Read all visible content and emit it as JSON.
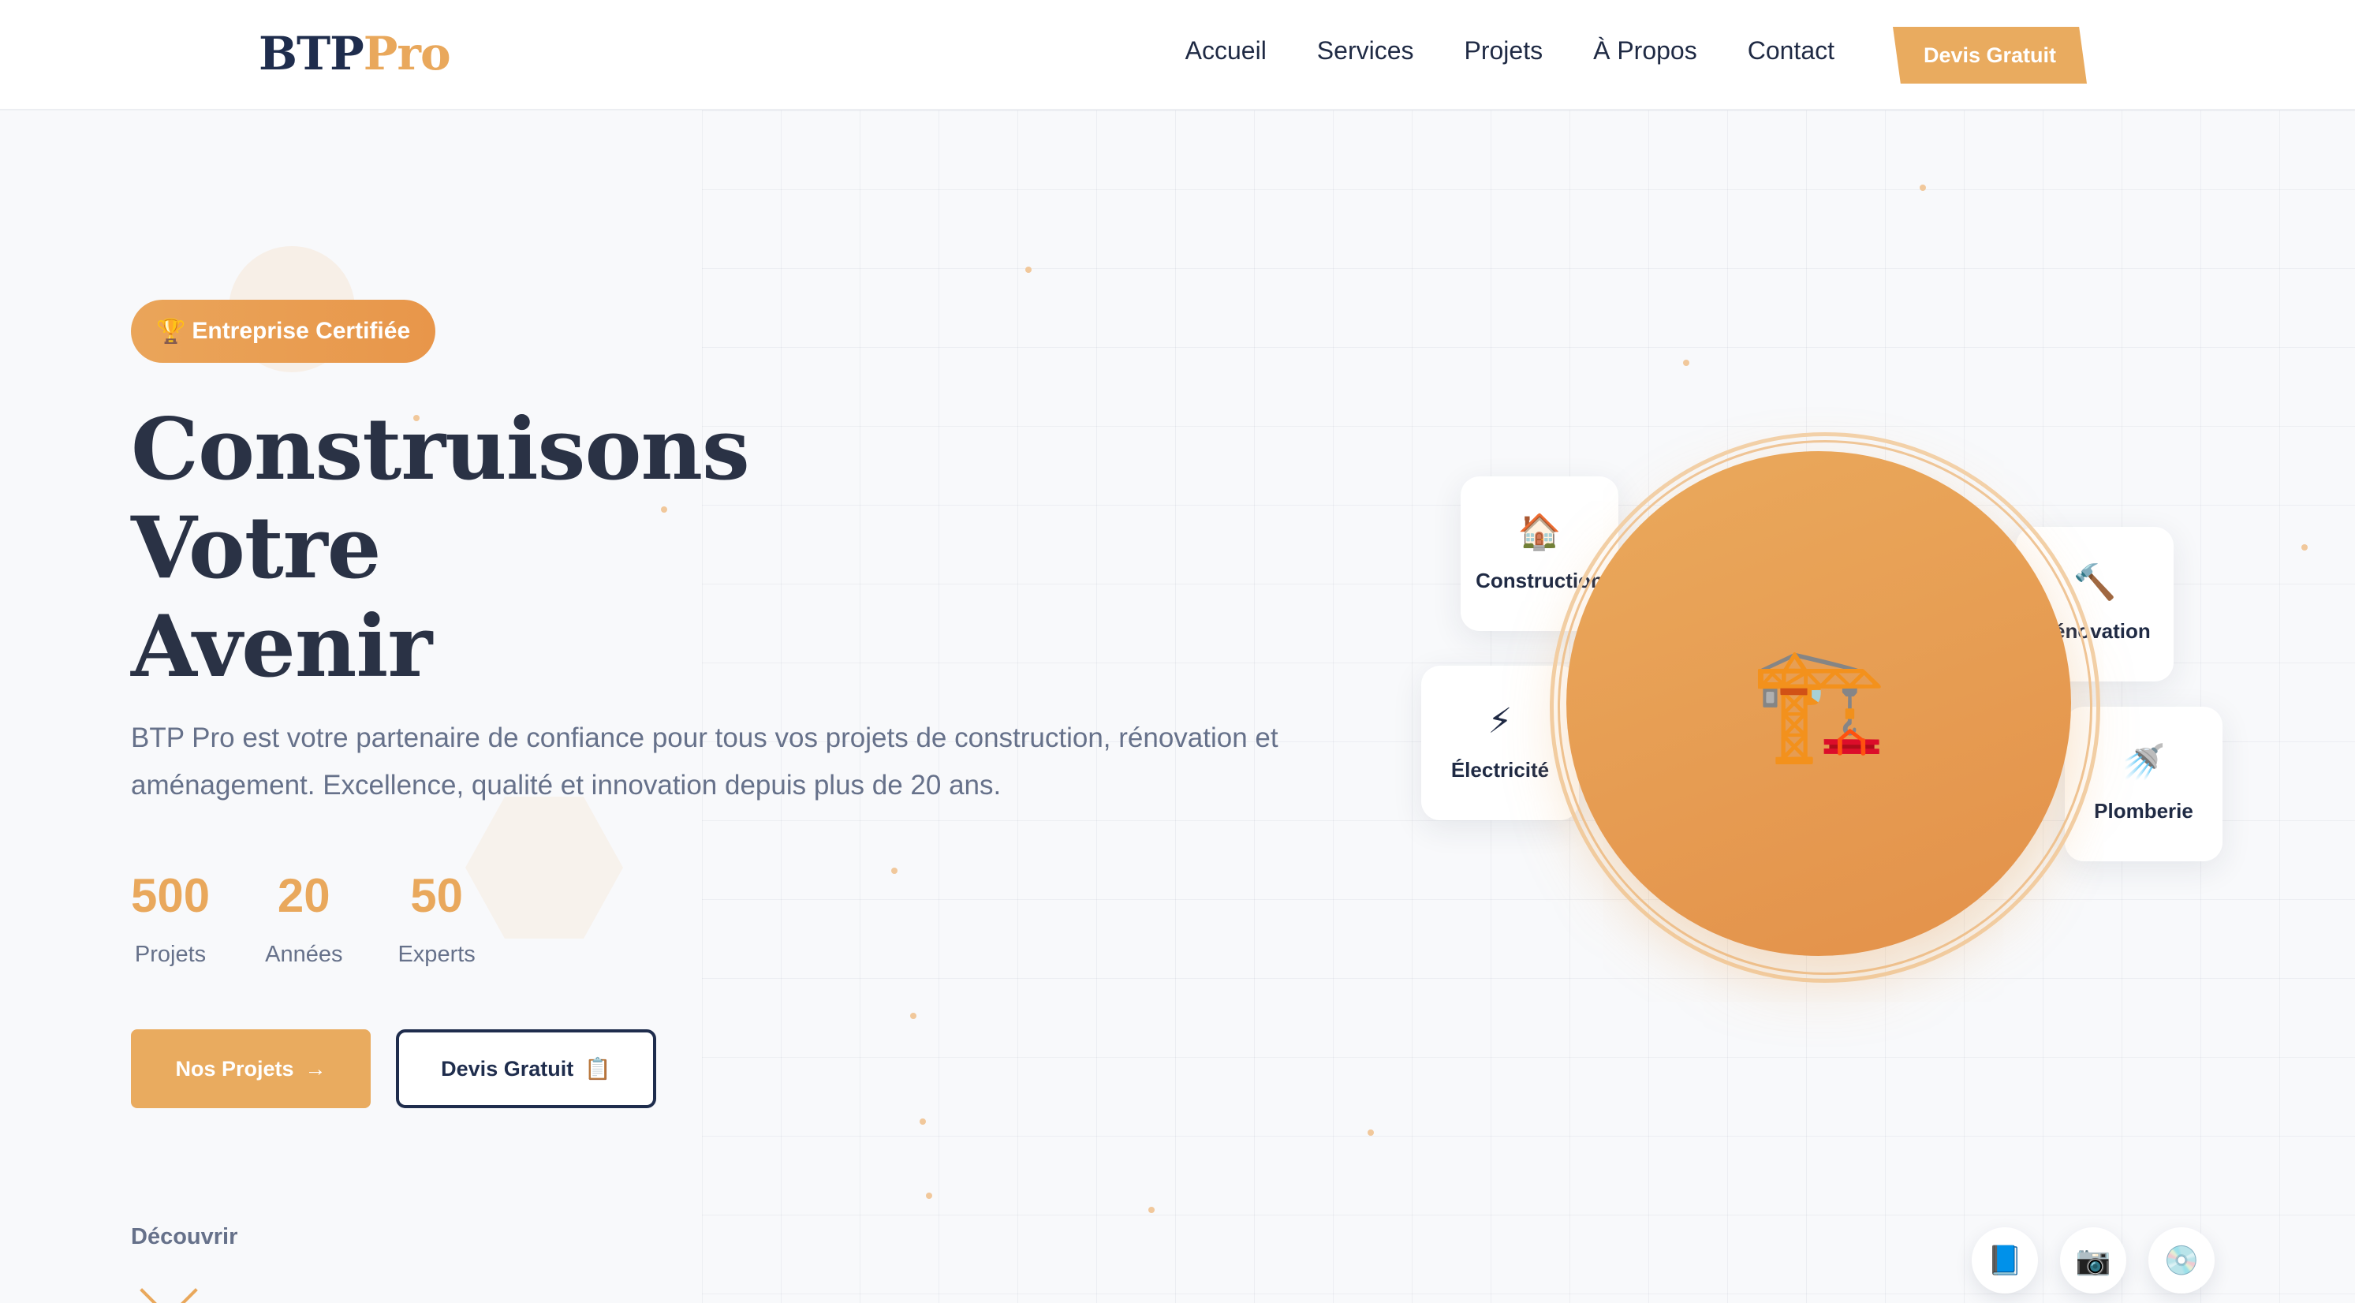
{
  "nav": {
    "logo_part1": "BTP",
    "logo_part2": "Pro",
    "links": [
      "Accueil",
      "Services",
      "Projets",
      "À Propos",
      "Contact"
    ],
    "cta": "Devis Gratuit"
  },
  "hero": {
    "badge_icon": "🏆",
    "badge_text": "Entreprise Certifiée",
    "headline": [
      "Construisons",
      "Votre",
      "Avenir"
    ],
    "intro": "BTP Pro est votre partenaire de confiance pour tous vos projets de construction, rénovation et aménagement. Excellence, qualité et innovation depuis plus de 20 ans.",
    "stats": [
      {
        "value": "500",
        "label": "Projets"
      },
      {
        "value": "20",
        "label": "Années"
      },
      {
        "value": "50",
        "label": "Experts"
      }
    ],
    "primary_button": "Nos Projets",
    "primary_button_icon": "→",
    "secondary_button": "Devis Gratuit",
    "secondary_button_icon": "📋",
    "discover": "Découvrir"
  },
  "visual": {
    "center_icon": "🏗️",
    "services": [
      {
        "icon": "🏠",
        "label": "Construction"
      },
      {
        "icon": "🔨",
        "label": "Rénovation"
      },
      {
        "icon": "⚡",
        "label": "Électricité"
      },
      {
        "icon": "🚿",
        "label": "Plomberie"
      }
    ]
  },
  "social": [
    "📘",
    "📷",
    "💿"
  ],
  "colors": {
    "accent": "#e9a85c",
    "navy": "#1f2d4d",
    "text_muted": "#66718a"
  }
}
